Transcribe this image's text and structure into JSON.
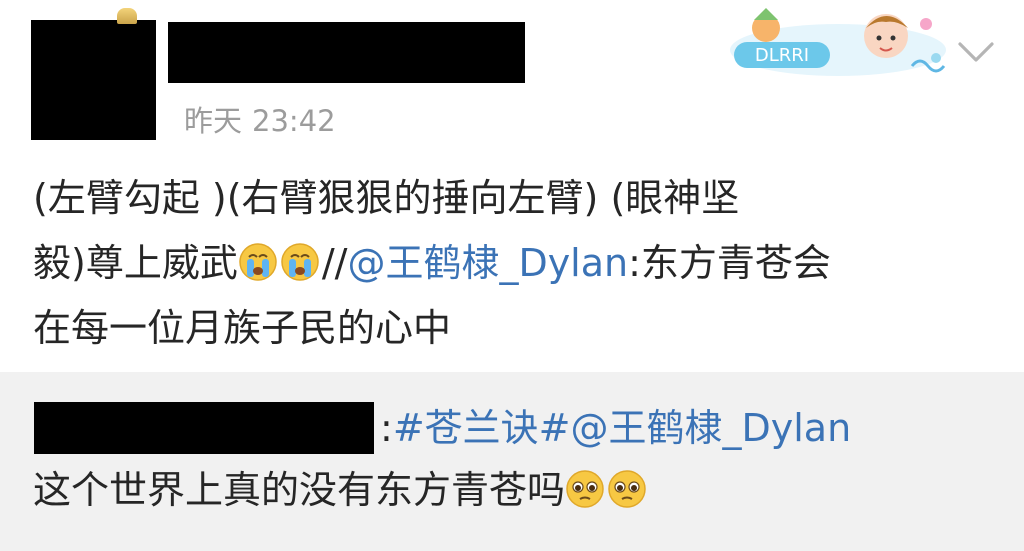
{
  "post": {
    "timestamp_day": "昨天",
    "timestamp_time": "23:42",
    "line1": "(左臂勾起 )(右臂狠狠的捶向左臂)  (眼神坚",
    "line2_prefix": "毅)尊上威武",
    "line2_sep": "//",
    "line2_mention": "@王鹤棣_Dylan",
    "line2_suffix": ":东方青苍会",
    "line3": "在每一位月族子民的心中",
    "emoji_name": "crying-face-icon"
  },
  "repost": {
    "colon": ":",
    "topic": "#苍兰诀#",
    "mention": "@王鹤棣_Dylan",
    "text": "这个世界上真的没有东方青苍吗",
    "emoji_name": "pleading-face-icon"
  },
  "colors": {
    "link": "#3b73b6",
    "timestamp": "#9c9c9c",
    "repost_bg": "#f1f1f1"
  }
}
